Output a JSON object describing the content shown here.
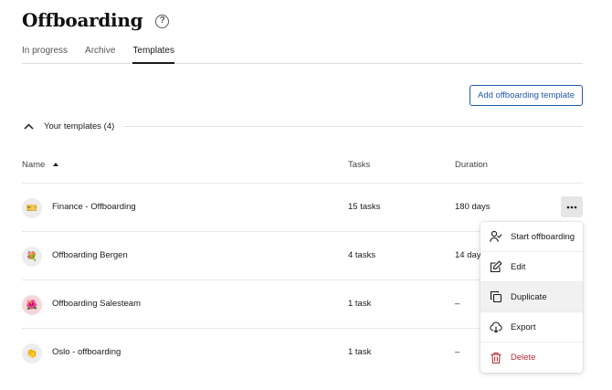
{
  "header": {
    "title": "Offboarding",
    "help_glyph": "?"
  },
  "tabs": [
    {
      "label": "In progress",
      "active": false
    },
    {
      "label": "Archive",
      "active": false
    },
    {
      "label": "Templates",
      "active": true
    }
  ],
  "add_button": {
    "label": "Add offboarding template"
  },
  "section": {
    "title": "Your templates (4)"
  },
  "columns": {
    "name": "Name",
    "tasks": "Tasks",
    "duration": "Duration"
  },
  "rows": [
    {
      "avatar": "🎫",
      "name": "Finance - Offboarding",
      "tasks": "15 tasks",
      "duration": "180 days"
    },
    {
      "avatar": "💐",
      "name": "Offboarding Bergen",
      "tasks": "4 tasks",
      "duration": "14 days"
    },
    {
      "avatar": "🌺",
      "name": "Offboarding Salesteam",
      "tasks": "1 task",
      "duration": "–"
    },
    {
      "avatar": "👏",
      "name": "Oslo - offboarding",
      "tasks": "1 task",
      "duration": "–"
    }
  ],
  "menu": {
    "items": [
      {
        "label": "Start offboarding",
        "icon": "user-check-icon"
      },
      {
        "label": "Edit",
        "icon": "edit-icon"
      },
      {
        "label": "Duplicate",
        "icon": "duplicate-icon"
      },
      {
        "label": "Export",
        "icon": "export-icon"
      },
      {
        "label": "Delete",
        "icon": "trash-icon"
      }
    ]
  },
  "colors": {
    "accent": "#1f5aa8",
    "danger": "#b0303a",
    "menu_hover": "#f1f1f1"
  }
}
